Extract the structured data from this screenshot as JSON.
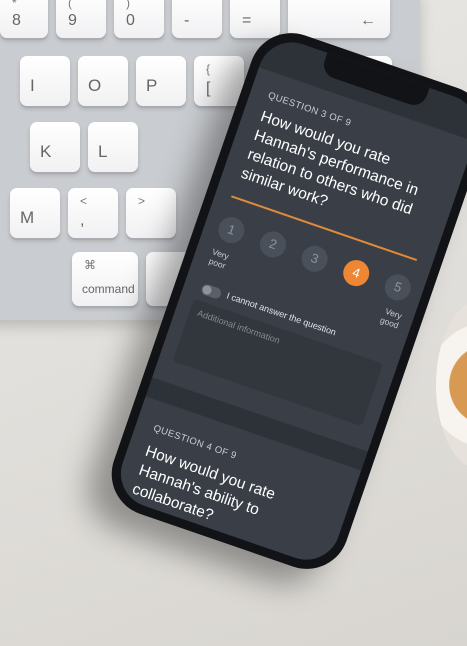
{
  "keyboard": {
    "keys": [
      {
        "top": "*",
        "bottom": "8"
      },
      {
        "top": "(",
        "bottom": "9"
      },
      {
        "top": ")",
        "bottom": "0"
      },
      {
        "top": "",
        "bottom": "-"
      },
      {
        "top": "",
        "bottom": "="
      },
      {
        "top": "",
        "bottom": "←"
      },
      {
        "top": "",
        "bottom": "I"
      },
      {
        "top": "",
        "bottom": "O"
      },
      {
        "top": "",
        "bottom": "P"
      },
      {
        "top": "{",
        "bottom": "["
      },
      {
        "top": "}",
        "bottom": "]"
      },
      {
        "top": "",
        "bottom": "↵"
      },
      {
        "top": "",
        "bottom": "K"
      },
      {
        "top": "",
        "bottom": "L"
      },
      {
        "top": "",
        "bottom": "M"
      },
      {
        "top": "<",
        "bottom": ","
      },
      {
        "top": ">",
        "bottom": ""
      },
      {
        "top": "⌘",
        "bottom": "command"
      }
    ]
  },
  "questions": [
    {
      "number_label": "QUESTION 3 OF 9",
      "text": "How would you rate Hannah's performance in relation to others who did similar work?",
      "rating": {
        "options": [
          "1",
          "2",
          "3",
          "4",
          "5"
        ],
        "selected": "4",
        "low_label": "Very poor",
        "high_label": "Very good"
      },
      "toggle_label": "I cannot answer the question",
      "toggle_on": false,
      "additional_placeholder": "Additional information"
    },
    {
      "number_label": "QUESTION 4 OF 9",
      "text": "How would you rate Hannah's ability to collaborate?"
    }
  ],
  "colors": {
    "accent": "#ef8633",
    "screen_bg": "#2d3138",
    "card_bg": "#3a3f47",
    "text": "#ffffff"
  }
}
